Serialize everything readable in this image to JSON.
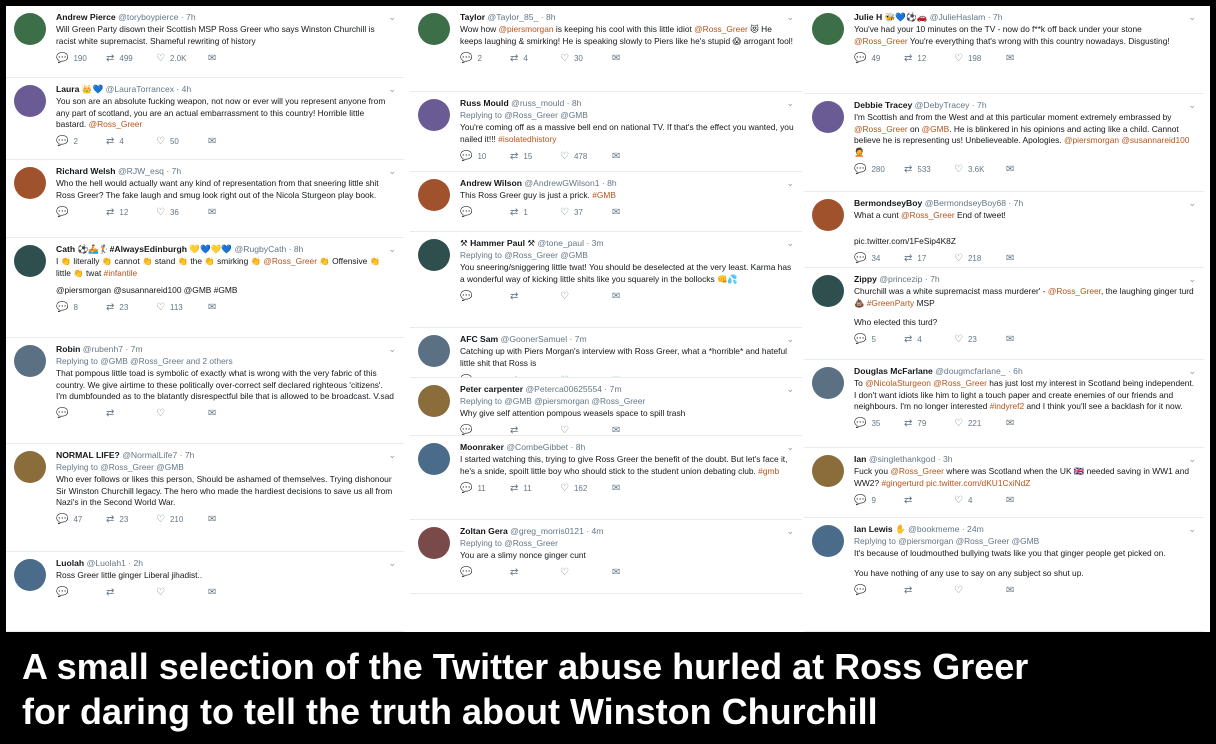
{
  "colors": {
    "link": "#b5541b",
    "text": "#14171a",
    "meta": "#657786",
    "caption_bg": "#000000",
    "caption_text": "#ffffff"
  },
  "icons": {
    "reply": "reply-icon",
    "retweet": "retweet-icon",
    "like": "heart-icon",
    "dm": "envelope-icon",
    "more": "chevron-down-icon"
  },
  "caption": {
    "line1": "A small selection of the Twitter abuse hurled at Ross Greer",
    "line2": "for daring to tell the truth about Winston Churchill"
  },
  "col1": [
    {
      "name": "Andrew Pierce",
      "handle": "@toryboypierce",
      "time": "· 7h",
      "text": "Will Green Party disown their Scottish MSP Ross Greer who says Winston Churchill is racist white supremacist. Shameful rewriting of history",
      "replies": "190",
      "retweets": "499",
      "likes": "2.0K"
    },
    {
      "name": "Laura 👑💙",
      "handle": "@LauraTorrancex",
      "time": "· 4h",
      "text_parts": [
        "You son are an absolute fucking weapon, not now or ever will you represent anyone from any part of scotland, you are an actual embarrassment to this country! Horrible little bastard. ",
        "@Ross_Greer"
      ],
      "replies": "2",
      "retweets": "4",
      "likes": "50"
    },
    {
      "name": "Richard Welsh",
      "handle": "@RJW_esq",
      "time": "· 7h",
      "text": "Who the hell would actually want any kind of representation from that sneering little shit Ross Greer? The fake laugh and smug look right out of the Nicola Sturgeon play book.",
      "replies": "",
      "retweets": "12",
      "likes": "36"
    },
    {
      "name": "Cath ⚽🚣🏌#AlwaysEdinburgh 💛💙💛💙",
      "handle": "@RugbyCath",
      "time": "· 8h",
      "text_parts": [
        "I 👏 literally 👏 cannot 👏 stand 👏 the 👏 smirking 👏 ",
        "@Ross_Greer",
        " 👏 Offensive 👏 little 👏 twat ",
        "#infantile"
      ],
      "mentions": "@piersmorgan @susannareid100 @GMB #GMB",
      "replies": "8",
      "retweets": "23",
      "likes": "113"
    },
    {
      "name": "Robin",
      "handle": "@rubenh7",
      "time": "· 7m",
      "replying": "Replying to @GMB @Ross_Greer and 2 others",
      "text": "That pompous little toad is symbolic of exactly what is wrong with the very fabric of this country. We give airtime to these politically over-correct self declared righteous 'citizens'. I'm dumbfounded as to the blatantly disrespectful bile that is allowed to be broadcast. V.sad",
      "replies": "",
      "retweets": "",
      "likes": ""
    },
    {
      "name": "NORMAL LIFE?",
      "handle": "@NormalLife7",
      "time": "· 7h",
      "replying": "Replying to @Ross_Greer @GMB",
      "text": "Who ever follows or likes this person, Should be ashamed of themselves. Trying dishonour Sir Winston Churchill legacy. The hero who made the hardiest decisions to save us all from Nazi's in the Second World War.",
      "replies": "47",
      "retweets": "23",
      "likes": "210"
    },
    {
      "name": "Luolah",
      "handle": "@Luolah1",
      "time": "· 2h",
      "text": "Ross Greer little ginger Liberal jihadist..",
      "replies": "",
      "retweets": "",
      "likes": ""
    }
  ],
  "col2": [
    {
      "name": "Taylor",
      "handle": "@Taylor_85_",
      "time": "· 8h",
      "text_parts": [
        "Wow how ",
        "@piersmorgan",
        " is keeping his cool with this little idiot ",
        "@Ross_Greer",
        " 😻 He keeps laughing & smirking! He is speaking slowly to Piers like he's stupid 😱 arrogant fool!"
      ],
      "replies": "2",
      "retweets": "4",
      "likes": "30"
    },
    {
      "name": "Russ Mould",
      "handle": "@russ_mould",
      "time": "· 8h",
      "replying": "Replying to @Ross_Greer @GMB",
      "text_parts": [
        "You're coming off as a massive bell end on national TV. If that's the effect you wanted, you nailed it!!! ",
        "#isolatedhistory"
      ],
      "replies": "10",
      "retweets": "15",
      "likes": "478"
    },
    {
      "name": "Andrew Wilson",
      "handle": "@AndrewGWilson1",
      "time": "· 8h",
      "text_parts": [
        "This Ross Greer guy is just a prick. ",
        "#GMB"
      ],
      "replies": "",
      "retweets": "1",
      "likes": "37"
    },
    {
      "name": "⚒ Hammer Paul ⚒",
      "handle": "@tone_paul",
      "time": "· 3m",
      "replying": "Replying to @Ross_Greer @GMB",
      "text": "You sneering/sniggering little twat! You should be deselected at the very least. Karma has a wonderful way of kicking little shits like you squarely in the bollocks 👊💦",
      "replies": "",
      "retweets": "",
      "likes": ""
    },
    {
      "name": "AFC Sam",
      "handle": "@GoonerSamuel",
      "time": "· 7m",
      "text": "Catching up with Piers Morgan's interview with Ross Greer, what a *horrible* and hateful little shit that Ross is",
      "replies": "",
      "retweets": "",
      "likes": ""
    },
    {
      "name": "Peter carpenter",
      "handle": "@Peterca00625554",
      "time": "· 7m",
      "replying": "Replying to @GMB @piersmorgan @Ross_Greer",
      "text": "Why give self attention pompous weasels  space to spill trash",
      "replies": "",
      "retweets": "",
      "likes": ""
    },
    {
      "name": "Moonraker",
      "handle": "@CombeGibbet",
      "time": "· 8h",
      "text_parts": [
        "I started watching this, trying to give Ross Greer the benefit of the doubt. But let's face it, he's a snide, spoilt little boy who should stick to the student union debating club. ",
        "#gmb"
      ],
      "replies": "11",
      "retweets": "11",
      "likes": "162"
    },
    {
      "name": "Zoltan Gera",
      "handle": "@greg_morris0121",
      "time": "· 4m",
      "replying": "Replying to @Ross_Greer",
      "text": "You are a slimy nonce ginger cunt",
      "replies": "",
      "retweets": "",
      "likes": ""
    }
  ],
  "col3": [
    {
      "name": "Julie H 🐝💙⚽🚗",
      "handle": "@JulieHaslam",
      "time": "· 7h",
      "text_parts": [
        "You've had your 10 minutes on the TV - now do f**k off back under your stone ",
        "@Ross_Greer",
        " You're everything that's wrong with this country nowadays. Disgusting!"
      ],
      "replies": "49",
      "retweets": "12",
      "likes": "198"
    },
    {
      "name": "Debbie Tracey",
      "handle": "@DebyTracey",
      "time": "· 7h",
      "text_parts": [
        "I'm Scottish and from the West and at this particular moment extremely embrassed by ",
        "@Ross_Greer",
        " on ",
        "@GMB",
        ". He is blinkered in his opinions and acting like a child. Cannot believe he is representing us! Unbelieveable. Apologies. ",
        "@piersmorgan @susannareid100",
        " 🤦"
      ],
      "replies": "280",
      "retweets": "533",
      "likes": "3.6K"
    },
    {
      "name": "BermondseyBoy",
      "handle": "@BermondseyBoy68",
      "time": "· 7h",
      "text_parts": [
        "What a cunt ",
        "@Ross_Greer",
        " End of tweet!"
      ],
      "link": "pic.twitter.com/1FeSip4K8Z",
      "replies": "34",
      "retweets": "17",
      "likes": "218"
    },
    {
      "name": "Zippy",
      "handle": "@princezip",
      "time": "· 7h",
      "text_parts": [
        "Churchill was a white supremacist mass murderer' - ",
        "@Ross_Greer",
        ", the laughing ginger turd💩 ",
        "#GreenParty",
        " MSP"
      ],
      "extra": "Who elected this turd?",
      "replies": "5",
      "retweets": "4",
      "likes": "23"
    },
    {
      "name": "Douglas McFarlane",
      "handle": "@dougmcfarlane_",
      "time": "· 6h",
      "text_parts": [
        "To ",
        "@NicolaSturgeon",
        " ",
        "@Ross_Greer",
        " has just lost my interest in Scotland being independent. I don't want idiots like him to light a touch paper and create enemies of our friends and neighbours. I'm no longer interested ",
        "#indyref2",
        " and I think you'll see a backlash for it now."
      ],
      "replies": "35",
      "retweets": "79",
      "likes": "221"
    },
    {
      "name": "Ian",
      "handle": "@singlethankgod",
      "time": "· 3h",
      "text_parts": [
        "Fuck you ",
        "@Ross_Greer",
        " where was Scotland when the UK 🇬🇧 needed saving in WW1 and WW2? ",
        "#gingerturd pic.twitter.com/dKU1CxiNdZ"
      ],
      "replies": "9",
      "retweets": "",
      "likes": "4"
    },
    {
      "name": "Ian Lewis ✋",
      "handle": "@bookmeme",
      "time": "· 24m",
      "replying": "Replying to @piersmorgan @Ross_Greer @GMB",
      "text": "It's because of loudmouthed bullying twats like you that ginger people get picked on.",
      "extra": "You have nothing of any use to say on any subject so shut up.",
      "replies": "",
      "retweets": "",
      "likes": ""
    }
  ]
}
